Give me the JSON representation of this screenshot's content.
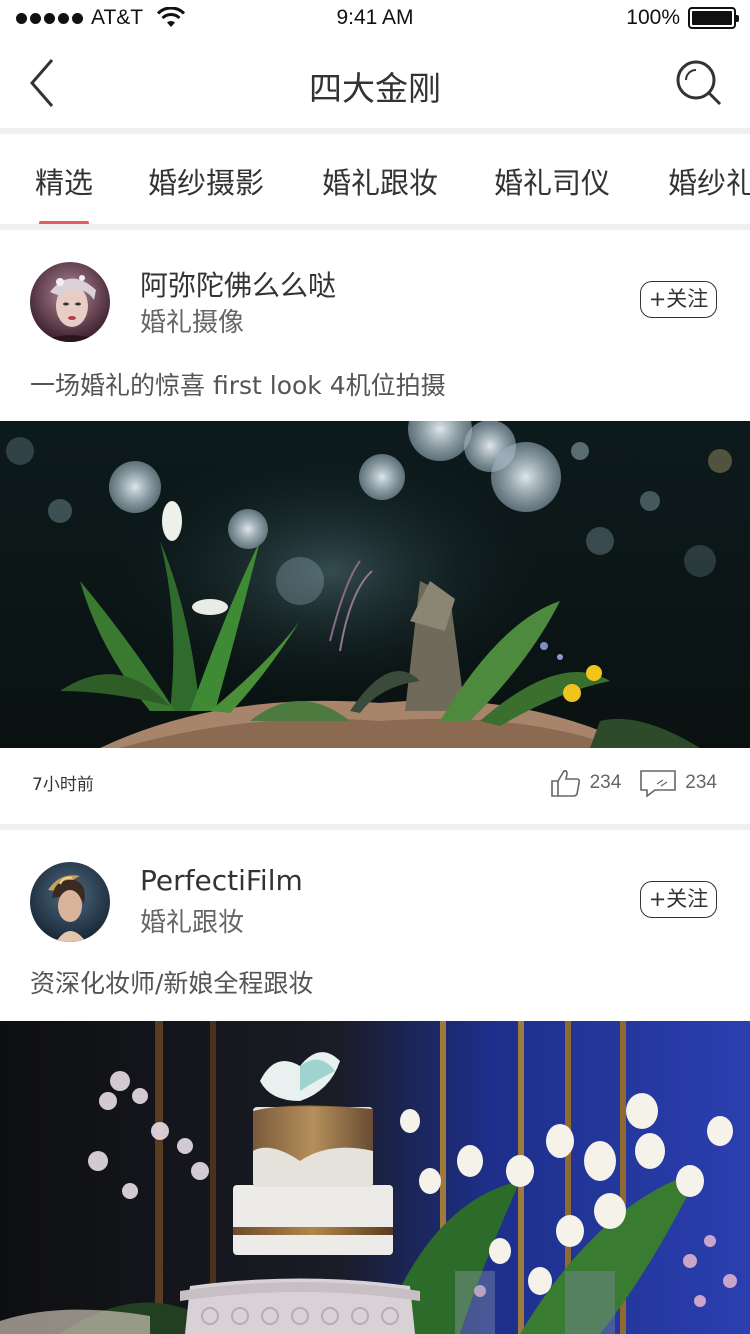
{
  "status_bar": {
    "carrier": "AT&T",
    "time": "9:41 AM",
    "battery_percent": "100%",
    "signal_bars": 5,
    "icons": [
      "signal-dots-icon",
      "wifi-icon",
      "battery-icon"
    ]
  },
  "nav": {
    "title": "四大金刚",
    "back_icon": "chevron-left-icon",
    "search_icon": "search-icon"
  },
  "tabs": {
    "items": [
      {
        "label": "精选",
        "active": true
      },
      {
        "label": "婚纱摄影",
        "active": false
      },
      {
        "label": "婚礼跟妆",
        "active": false
      },
      {
        "label": "婚礼司仪",
        "active": false
      },
      {
        "label": "婚纱礼",
        "active": false
      }
    ],
    "accent_color": "#e85a63"
  },
  "posts": [
    {
      "author": "阿弥陀佛么么哒",
      "category": "婚礼摄像",
      "follow_label": "+关注",
      "description": "一场婚礼的惊喜  first look 4机位拍摄",
      "time_ago": "7小时前",
      "likes": "234",
      "comments": "234"
    },
    {
      "author": "PerfectiFilm",
      "category": "婚礼跟妆",
      "follow_label": "+关注",
      "description": "资深化妆师/新娘全程跟妆"
    }
  ]
}
